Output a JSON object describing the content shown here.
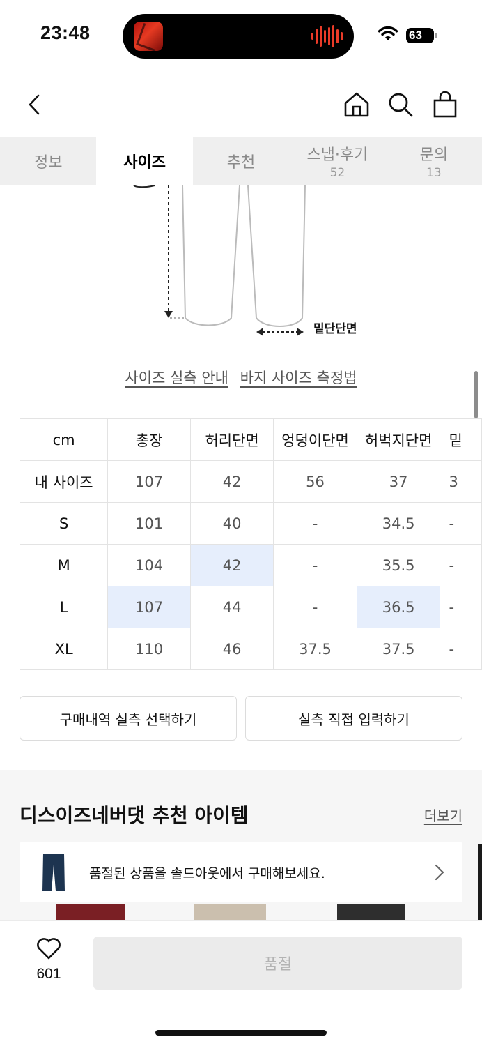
{
  "status": {
    "time": "23:48",
    "battery": "63"
  },
  "tabs": [
    {
      "label": "정보",
      "count": ""
    },
    {
      "label": "사이즈",
      "count": ""
    },
    {
      "label": "추천",
      "count": ""
    },
    {
      "label": "스냅·후기",
      "count": "52"
    },
    {
      "label": "문의",
      "count": "13"
    }
  ],
  "diagram": {
    "hem_label": "밑단단면"
  },
  "guide_links": {
    "size_guide": "사이즈 실측 안내",
    "measure_guide": "바지 사이즈 측정법"
  },
  "size_table": {
    "headers": [
      "cm",
      "총장",
      "허리단면",
      "엉덩이단면",
      "허벅지단면",
      "밑"
    ],
    "rows": [
      {
        "label": "내 사이즈",
        "cells": [
          "107",
          "42",
          "56",
          "37",
          "3"
        ]
      },
      {
        "label": "S",
        "cells": [
          "101",
          "40",
          "-",
          "34.5",
          "-"
        ]
      },
      {
        "label": "M",
        "cells": [
          "104",
          "42",
          "-",
          "35.5",
          "-"
        ]
      },
      {
        "label": "L",
        "cells": [
          "107",
          "44",
          "-",
          "36.5",
          "-"
        ]
      },
      {
        "label": "XL",
        "cells": [
          "110",
          "46",
          "37.5",
          "37.5",
          "-"
        ]
      }
    ]
  },
  "actions": {
    "purchase_history": "구매내역 실측 선택하기",
    "direct_input": "실측 직접 입력하기"
  },
  "recommend": {
    "title": "디스이즈네버댓 추천 아이템",
    "more": "더보기",
    "sold_out_banner": "품절된 상품을 솔드아웃에서 구매해보세요."
  },
  "bottom": {
    "like_count": "601",
    "buy_label": "품절"
  },
  "colors": {
    "highlight": "#e6eefc",
    "tab_bg": "#efefef",
    "disabled_btn": "#ebebeb"
  },
  "icons": [
    "back-arrow-icon",
    "home-icon",
    "search-icon",
    "shopping-bag-icon",
    "heart-icon",
    "chevron-right-icon"
  ]
}
